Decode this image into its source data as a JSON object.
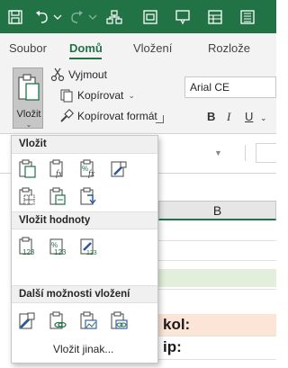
{
  "titlebar": {
    "icons": [
      "save-icon",
      "undo-icon",
      "redo-icon",
      "share-icon",
      "form-icon",
      "shape-icon",
      "table-icon",
      "more-icon"
    ],
    "color": "#217346"
  },
  "ribbon_tabs": [
    {
      "label": "Soubor",
      "active": false
    },
    {
      "label": "Domů",
      "active": true
    },
    {
      "label": "Vložení",
      "active": false
    },
    {
      "label": "Rozlože",
      "active": false
    }
  ],
  "clipboard": {
    "paste_label": "Vložit",
    "cut_label": "Vyjmout",
    "copy_label": "Kopírovat",
    "format_painter_label": "Kopírovat formát"
  },
  "font": {
    "name": "Arial CE",
    "bold": "B",
    "italic": "I",
    "underline": "U"
  },
  "sheet": {
    "column_b": "B",
    "cell_1": "kol:",
    "cell_2": "ip:"
  },
  "paste_menu": {
    "section_paste": "Vložit",
    "section_values": "Vložit hodnoty",
    "section_other": "Další možnosti vložení",
    "paste_special_label": "Vložit jinak..."
  },
  "colors": {
    "accent": "#217346",
    "highlight_row": "#fce4d6",
    "green_row": "#e2efda"
  }
}
